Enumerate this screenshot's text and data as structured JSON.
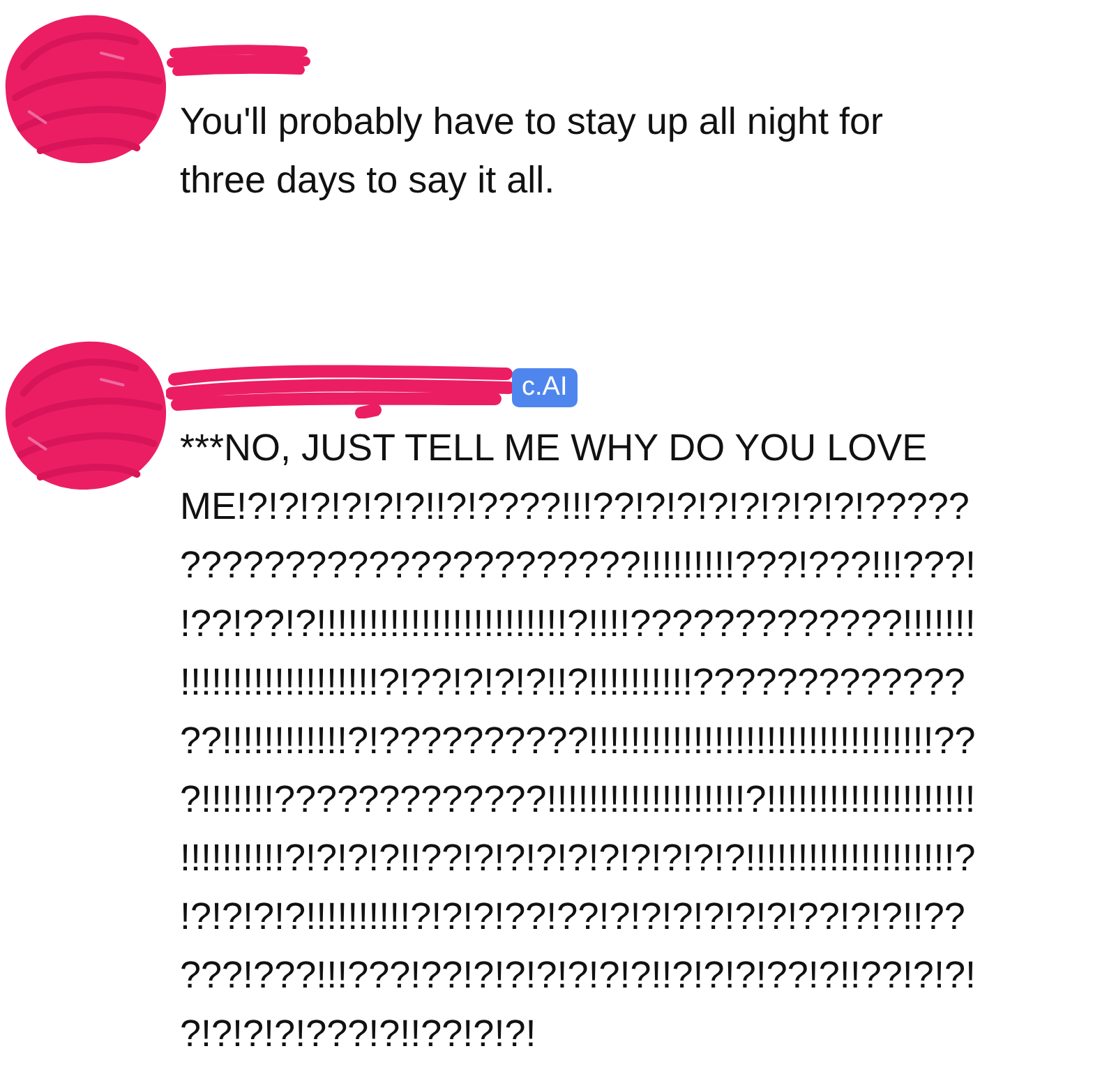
{
  "messages": [
    {
      "text": "You'll probably have to stay up all night for three days to say it all."
    },
    {
      "badge": "c.AI",
      "text": "***NO, JUST TELL ME WHY DO YOU LOVE ME!?!?!?!?!?!?!!?!????!!!??!?!?!?!?!?!?!?!???????????????????????????!!!!!!!!!???!???!!!???!!??!??!?!!!!!!!!!!!!!!!!!!!!!!!!?!!!!?????????????!!!!!!!!!!!!!!!!!!!!!!!!!!?!??!?!?!?!!?!!!!!!!!!!???????????????!!!!!!!!!!!!?!??????????!!!!!!!!!!!!!!!!!!!!!!!!!!!!!!!!!???!!!!!!!?????????????!!!!!!!!!!!!!!!!!!!?!!!!!!!!!!!!!!!!!!!!!!!!!!!!!!?!?!?!?!!??!?!?!?!?!?!?!?!?!?!!!!!!!!!!!!!!!!!!!!?!?!?!?!?!!!!!!!!!!?!?!?!??!??!?!?!?!?!?!?!??!?!?!!?????!???!!!???!??!?!?!?!?!?!?!!?!?!?!??!?!!??!?!?!?!?!?!?!???!?!!??!?!?!"
    }
  ]
}
